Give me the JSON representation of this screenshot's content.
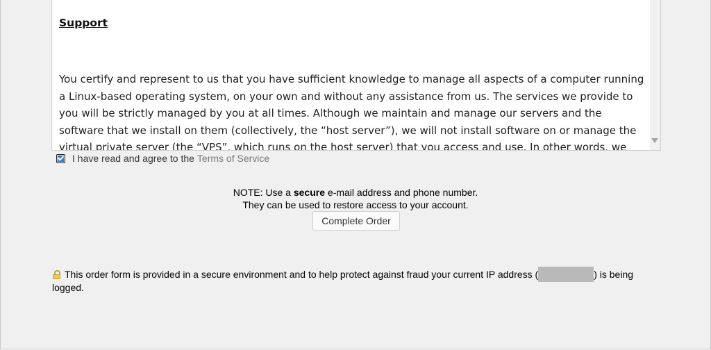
{
  "terms": {
    "heading": "Support",
    "paragraph": "You certify and represent to us that you have sufficient knowledge to manage all aspects of a computer running a Linux-based operating system, on your own and without any assistance from us. The services we provide to you will be strictly managed by you at all times. Although we maintain and manage our servers and the software that we install on them (collectively, the “host server”), we will not install software on or manage the virtual private server (the “VPS”, which runs on the host server) that you access and use. In other words, we are only"
  },
  "agree": {
    "checked": true,
    "label": "I have read and agree to the",
    "link": "Terms of Service"
  },
  "note": {
    "prefix": "NOTE: Use a",
    "bold": "secure",
    "suffix": "e-mail address and phone number.",
    "line2": "They can be used to restore access to your account."
  },
  "complete_button": "Complete Order",
  "security": {
    "text_before": "This order form is provided in a secure environment and to help protect against fraud your current IP address (",
    "text_after": ") is being logged."
  },
  "colors": {
    "background": "#f0f0f0",
    "link": "#777777",
    "checkbox": "#3c78c8"
  }
}
